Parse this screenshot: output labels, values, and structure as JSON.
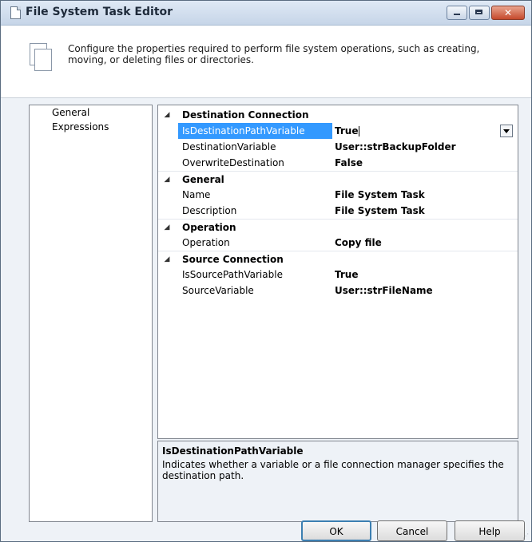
{
  "window": {
    "title": "File System Task Editor",
    "close_glyph": "✕"
  },
  "header": {
    "description": "Configure the properties required to perform file system operations, such as creating, moving, or deleting files or directories.",
    "icon": "document-icon"
  },
  "nav": {
    "items": [
      "General",
      "Expressions"
    ]
  },
  "grid": {
    "categories": [
      {
        "label": "Destination Connection",
        "props": [
          {
            "name": "IsDestinationPathVariable",
            "value": "True"
          },
          {
            "name": "DestinationVariable",
            "value": "User::strBackupFolder"
          },
          {
            "name": "OverwriteDestination",
            "value": "False"
          }
        ]
      },
      {
        "label": "General",
        "props": [
          {
            "name": "Name",
            "value": "File System Task"
          },
          {
            "name": "Description",
            "value": "File System Task"
          }
        ]
      },
      {
        "label": "Operation",
        "props": [
          {
            "name": "Operation",
            "value": "Copy file"
          }
        ]
      },
      {
        "label": "Source Connection",
        "props": [
          {
            "name": "IsSourcePathVariable",
            "value": "True"
          },
          {
            "name": "SourceVariable",
            "value": "User::strFileName"
          }
        ]
      }
    ],
    "selected_property": "IsDestinationPathVariable"
  },
  "help": {
    "title": "IsDestinationPathVariable",
    "description": "Indicates whether a variable or a file connection manager specifies the destination path."
  },
  "buttons": {
    "ok": "OK",
    "cancel": "Cancel",
    "help": "Help"
  },
  "colors": {
    "selection": "#3399ff",
    "title_bar": "#c6d5e8"
  }
}
